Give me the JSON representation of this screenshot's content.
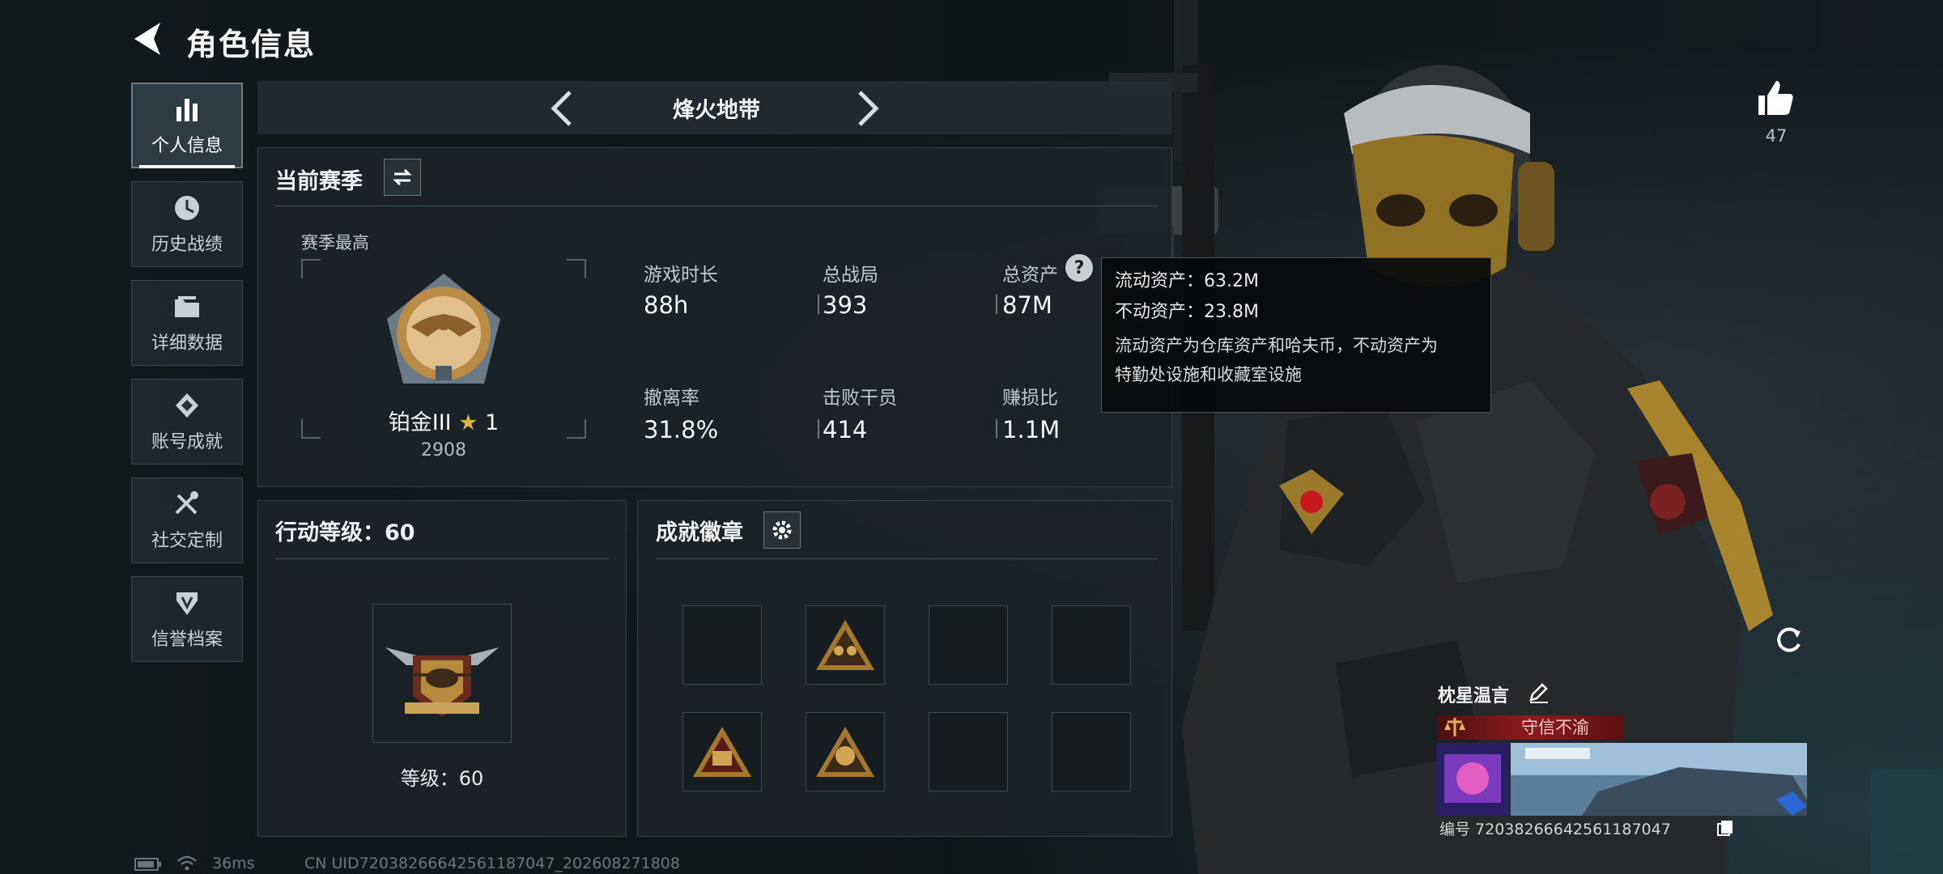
{
  "header": {
    "title": "角色信息"
  },
  "nav": {
    "items": [
      {
        "label": "个人信息",
        "icon": "bar-chart-icon"
      },
      {
        "label": "历史战绩",
        "icon": "clock-icon"
      },
      {
        "label": "详细数据",
        "icon": "folder-icon"
      },
      {
        "label": "账号成就",
        "icon": "achievement-icon"
      },
      {
        "label": "社交定制",
        "icon": "tools-icon"
      },
      {
        "label": "信誉档案",
        "icon": "shield-icon"
      }
    ]
  },
  "mode": {
    "name": "烽火地带"
  },
  "season": {
    "title": "当前赛季",
    "best_label": "赛季最高",
    "rank_name": "铂金III",
    "rank_stars": "1",
    "rank_points": "2908",
    "stats": [
      {
        "label": "游戏时长",
        "value": "88h"
      },
      {
        "label": "总战局",
        "value": "393"
      },
      {
        "label": "总资产",
        "value": "87M"
      },
      {
        "label": "撤离率",
        "value": "31.8%"
      },
      {
        "label": "击败干员",
        "value": "414"
      },
      {
        "label": "赚损比",
        "value": "1.1M"
      }
    ]
  },
  "tooltip": {
    "line1": "流动资产：63.2M",
    "line2": "不动资产：23.8M",
    "desc1": "流动资产为仓库资产和哈夫币，不动资产为",
    "desc2": "特勤处设施和收藏室设施"
  },
  "level": {
    "title": "行动等级：60",
    "level_text": "等级：60"
  },
  "badges": {
    "title": "成就徽章",
    "slots": [
      "empty",
      "badge",
      "empty",
      "empty",
      "badge",
      "badge",
      "empty",
      "empty"
    ]
  },
  "profile": {
    "likes": "47",
    "name": "枕星温言",
    "title": "守信不渝",
    "id_text": "编号 7203826664256118704​7"
  },
  "status_bar": {
    "ping": "36ms",
    "uid": "CN UID7203826664256118704​7_202608271808"
  },
  "colors": {
    "accent_gold": "#c99a4a",
    "banner_red": "#8e1a1f",
    "panel_bg": "#1c2328"
  }
}
